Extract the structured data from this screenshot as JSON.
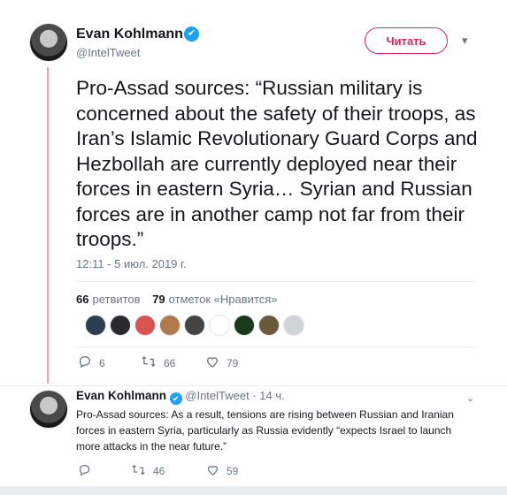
{
  "main_tweet": {
    "author_name": "Evan Kohlmann",
    "verified_mark": "✔",
    "handle": "@IntelTweet",
    "follow_label": "Читать",
    "menu_icon": "▾",
    "text": "Pro-Assad sources: “Russian military is concerned about the safety of their troops, as Iran’s Islamic Revolutionary Guard Corps and Hezbollah are currently deployed near their forces in eastern Syria… Syrian and Russian forces are in another camp not far from their troops.”",
    "timestamp": "12:11 - 5 июл. 2019 г.",
    "retweets_count": "66",
    "retweets_label": "ретвитов",
    "likes_count": "79",
    "likes_label": "отметок «Нравится»",
    "liker_colors": [
      "#2c3e50",
      "#2b2b2b",
      "#d9534f",
      "#b07a4a",
      "#444444",
      "#ffffff",
      "#1a3a1a",
      "#6b5a3a",
      "#d0d5da"
    ],
    "actions": {
      "reply_count": "6",
      "retweet_count": "66",
      "like_count": "79"
    }
  },
  "reply_tweet": {
    "author_name": "Evan Kohlmann",
    "verified_mark": "✔",
    "handle": "@IntelTweet",
    "time": "· 14 ч.",
    "menu_icon": "⌄",
    "text": "Pro-Assad sources: As a result, tensions are rising between Russian and Iranian forces in eastern Syria, particularly as Russia evidently “expects Israel to launch more attacks in the near future.”",
    "actions": {
      "retweet_count": "46",
      "like_count": "59"
    }
  },
  "icons": {
    "reply": "reply-icon",
    "retweet": "retweet-icon",
    "like": "heart-icon"
  }
}
